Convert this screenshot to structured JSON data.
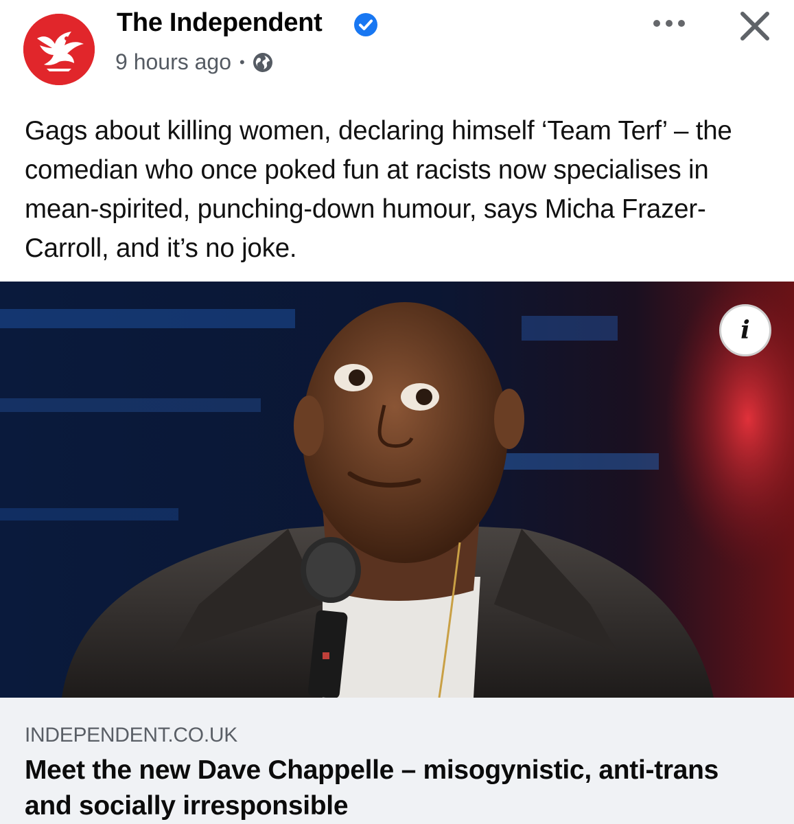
{
  "post": {
    "page_name": "The Independent",
    "timestamp": "9 hours ago",
    "separator": "•",
    "audience_icon": "globe-icon",
    "verified_icon": "verified-badge-icon",
    "more_icon": "more-options-icon",
    "close_icon": "close-icon",
    "caption": "Gags about killing women, declaring himself ‘Team Terf’ – the comedian who once poked fun at racists now specialises in mean-spirited, punching-down humour, says Micha Frazer-Carroll, and it’s no joke."
  },
  "image": {
    "description_icon": "article-photo",
    "info_label": "i"
  },
  "link": {
    "domain": "INDEPENDENT.CO.UK",
    "headline": "Meet the new Dave Chappelle – misogynistic, anti-trans and socially irresponsible"
  },
  "colors": {
    "brand_red": "#e1262b",
    "verified_blue": "#1877f2",
    "card_bg": "#f0f2f5"
  }
}
